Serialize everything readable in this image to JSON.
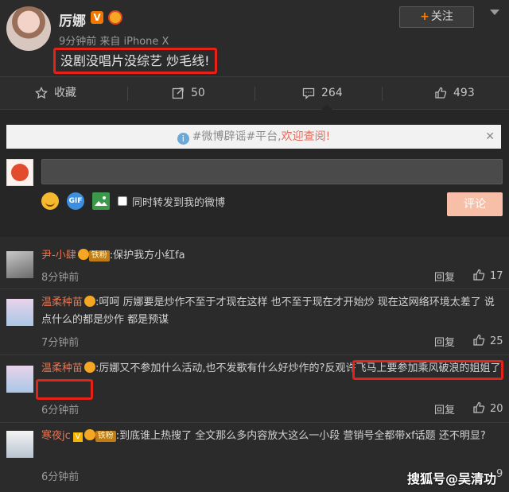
{
  "post": {
    "author": "厉娜",
    "meta": "9分钟前 来自 iPhone X",
    "follow_label": "关注",
    "text": "没剧没唱片没综艺 炒毛线!"
  },
  "actions": {
    "collect": "收藏",
    "repost": "50",
    "comment": "264",
    "like": "493"
  },
  "composer": {
    "notice_prefix": "#微博辟谣#平台,",
    "notice_link": "欢迎查阅!",
    "sync_label": "同时转发到我的微博",
    "submit_label": "评论"
  },
  "comments": [
    {
      "name": "尹-小肆",
      "fan_badge": "铁粉",
      "text": ":保护我方小红fa",
      "time": "8分钟前",
      "reply": "回复",
      "likes": "17"
    },
    {
      "name": "温柔种苗",
      "text": ":呵呵 厉娜要是炒作不至于才现在这样 也不至于现在才开始炒  现在这网络环境太差了 说点什么的都是炒作 都是预谋",
      "time": "7分钟前",
      "reply": "回复",
      "likes": "25"
    },
    {
      "name": "温柔种苗",
      "text_a": ":厉娜又不参加什么活动,也不发歌有什么好炒作的?",
      "text_b": "反观许飞马上要参加乘风破浪的姐姐了",
      "time": "6分钟前",
      "reply": "回复",
      "likes": "20"
    },
    {
      "name": "寒夜jc",
      "fan_badge": "铁粉",
      "text": ":到底谁上热搜了 全文那么多内容放大这么一小段 营销号全都带xf话题 还不明显?",
      "time": "6分钟前",
      "reply": "回复",
      "likes": "9"
    }
  ],
  "watermark": "搜狐号@吴清功",
  "colors": {
    "highlight": "#e62117",
    "name": "#eb7350",
    "accent": "#ff8200"
  }
}
